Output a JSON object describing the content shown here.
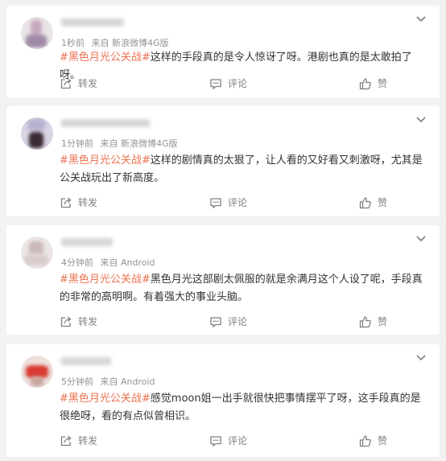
{
  "posts": [
    {
      "time": "1秒前",
      "source": "来自 新浪微博4G版",
      "hashtag": "#黑色月光公关战#",
      "text": "这样的手段真的是令人惊讶了呀。港剧也真的是太敢拍了呀。",
      "actions": {
        "forward": "转发",
        "comment": "评论",
        "like": "赞"
      }
    },
    {
      "time": "1分钟前",
      "source": "来自 新浪微博4G版",
      "hashtag": "#黑色月光公关战#",
      "text": "这样的剧情真的太狠了，让人看的又好看又刺激呀，尤其是公关战玩出了新高度。",
      "actions": {
        "forward": "转发",
        "comment": "评论",
        "like": "赞"
      }
    },
    {
      "time": "4分钟前",
      "source": "来自 Android",
      "hashtag": "#黑色月光公关战#",
      "text": "黑色月光这部剧太佩服的就是余满月这个人设了呢，手段真的非常的高明啊。有着强大的事业头脑。",
      "actions": {
        "forward": "转发",
        "comment": "评论",
        "like": "赞"
      }
    },
    {
      "time": "5分钟前",
      "source": "来自 Android",
      "hashtag": "#黑色月光公关战#",
      "text": "感觉moon姐一出手就很快把事情摆平了呀，这手段真的是很绝呀，看的有点似曾相识。",
      "actions": {
        "forward": "转发",
        "comment": "评论",
        "like": "赞"
      }
    }
  ],
  "colors": {
    "hashtag": "#eb7350",
    "meta": "#939393",
    "action": "#808080"
  },
  "icons": {
    "menu": "chevron-down-icon",
    "forward": "forward-icon",
    "comment": "comment-icon",
    "like": "thumbs-up-icon"
  }
}
